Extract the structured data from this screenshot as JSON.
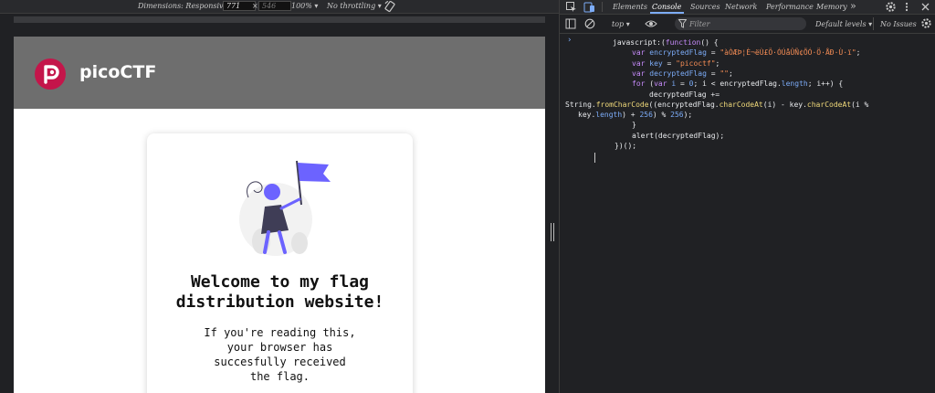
{
  "device_toolbar": {
    "dimensions_label": "Dimensions: Responsive ▾",
    "width_value": "771",
    "times": "×",
    "height_value": "546",
    "zoom": "100% ▾",
    "throttle": "No throttling ▾"
  },
  "site": {
    "brand": "picoCTF",
    "card_title_line1": "Welcome to my flag",
    "card_title_line2": "distribution website!",
    "body_line1": "If you're reading this,",
    "body_line2": "your browser has",
    "body_line3": "succesfully received",
    "body_line4": "the flag.",
    "colors": {
      "header": "#6e6e6e",
      "logo": "#c4154a",
      "illustration_accent": "#6c63ff"
    }
  },
  "devtools": {
    "tabs": [
      "Elements",
      "Console",
      "Sources",
      "Network",
      "Performance",
      "Memory"
    ],
    "active_tab": "Console",
    "more_tabs": "»",
    "context": "top ▾",
    "filter_placeholder": "Filter",
    "levels": "Default levels ▾",
    "issues": "No Issues",
    "prompt": "›",
    "code": {
      "l1a": "javascript:(",
      "l1b": "function",
      "l1c": "() {",
      "l2a": "var ",
      "l2b": "encryptedFlag",
      "l2c": " = ",
      "l2d": "\"àÒÆÞ¦È¬ëÙ£Ö·ÓÚåÛÑ¢ÕÓ·Ö·ÅÐ·Ù·ï\"",
      "l2e": ";",
      "l3a": "var ",
      "l3b": "key",
      "l3c": " = ",
      "l3d": "\"picoctf\"",
      "l3e": ";",
      "l4a": "var ",
      "l4b": "decryptedFlag",
      "l4c": " = ",
      "l4d": "\"\"",
      "l4e": ";",
      "l5a": "for",
      "l5b": " (",
      "l5c": "var ",
      "l5d": "i",
      "l5e": " = ",
      "l5f": "0",
      "l5g": "; i < encryptedFlag.",
      "l5h": "length",
      "l5i": "; i++) {",
      "l6": "decryptedFlag +=",
      "l7a": "String.",
      "l7b": "fromCharCode",
      "l7c": "((encryptedFlag.",
      "l7d": "charCodeAt",
      "l7e": "(i) - key.",
      "l7f": "charCodeAt",
      "l7g": "(i %",
      "l8a": "key.",
      "l8b": "length",
      "l8c": ") + ",
      "l8d": "256",
      "l8e": ") % ",
      "l8f": "256",
      "l8g": ");",
      "l9": "}",
      "l10": "alert(decryptedFlag);",
      "l11": "})();"
    }
  }
}
